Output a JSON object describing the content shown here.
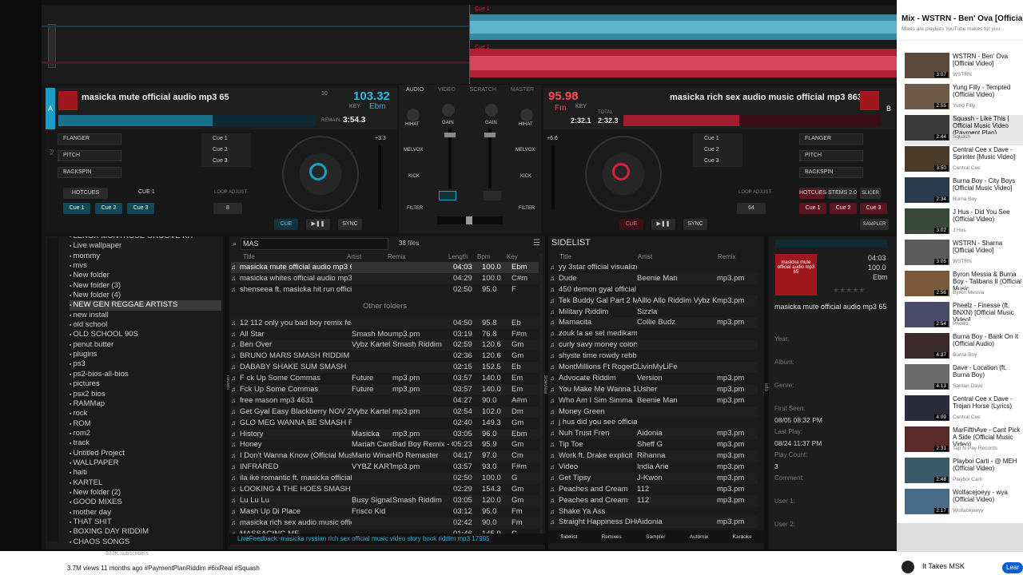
{
  "deckA": {
    "title": "masicka mute official audio mp3 65",
    "bpm": "103.32",
    "key_label": "KEY",
    "key": "Ebm",
    "time": "3:54.3",
    "remain": "REMAIN",
    "pitch": "10",
    "letter": "A"
  },
  "deckB": {
    "title": "masicka rich sex audio music official mp3 86339",
    "bpm": "95.98",
    "key_label": "KEY",
    "key": "Fm",
    "time1": "2:32.1",
    "time2": "2:32.3",
    "total": "TOTAL",
    "letter": "B"
  },
  "wave": {
    "cue_top": "Cue 1",
    "cue_bottom": "Cue 1"
  },
  "mixer": {
    "tabs": [
      "AUDIO",
      "VIDEO",
      "SCRATCH",
      "MASTER"
    ],
    "hihat": "HIHAT",
    "gain": "GAIN",
    "melvox": "MELVOX",
    "kick": "KICK",
    "filter": "FILTER"
  },
  "fxA": {
    "items": [
      "FLANGER",
      "PITCH",
      "BACKSPIN"
    ],
    "cues": [
      "Cue 1",
      "Cue 2",
      "Cue 3"
    ],
    "pads": [
      "Cue 1",
      "Cue 2",
      "Cue 3"
    ],
    "hotcues": "HOTCUES",
    "cue1": "CUE 1",
    "loop": "8",
    "plus": "+3.3",
    "cue": "CUE",
    "sync": "SYNC",
    "fx_label": "FX",
    "loop_adjust": "LOOP ADJUST",
    "pads_label": "PADS",
    "hotcue_label": "HOTCUE"
  },
  "fxB": {
    "items": [
      "FLANGER",
      "PITCH",
      "BACKSPIN"
    ],
    "cues": [
      "Cue 1",
      "Cue 2",
      "Cue 3"
    ],
    "pads": [
      "Cue 1",
      "Cue 2",
      "Cue 3"
    ],
    "pad_tabs": [
      "HOTCUES",
      "STEMS 2.0",
      "SLICER",
      "SAMPLER"
    ],
    "loop": "64",
    "plus": "+6.6",
    "cue": "CUE",
    "sync": "SYNC",
    "loop_adjust": "LOOP ADJUST"
  },
  "folders": [
    "LENOX MONTROSE GROOVE KIT",
    "Live wallpaper",
    "mommy",
    "mvs",
    "New folder",
    "New folder (3)",
    "New folder (4)",
    "NEW GEN REGGAE ARTISTS",
    "new install",
    "old school",
    "OLD SCHOOL 90S",
    "penut butter",
    "plugins",
    "ps3",
    "ps2-bios-all-bios",
    "pictures",
    "psx2 bios",
    "RAMMap",
    "rock",
    "ROM",
    "rom2",
    "track",
    "Untitled Project",
    "WALLPAPER",
    "haiti",
    "KARTEL",
    "New folder (2)",
    "GOOD MIXES",
    "mother day",
    "THAT SHIT",
    "BOXING DAY RIDDIM",
    "CHAOS SONGS"
  ],
  "search": {
    "value": "MAS",
    "count": "38 files"
  },
  "tracklist": {
    "headers": [
      "Title",
      "Artist",
      "Remix",
      "Length",
      "Bpm",
      "Key"
    ],
    "other": "Other folders",
    "rows": [
      [
        "masicka mute official audio mp3 65",
        "",
        "",
        "04:03",
        "100.0",
        "Ebm"
      ],
      [
        "masicka whites official audio mp3 77",
        "",
        "",
        "04:29",
        "100.0",
        "C#m"
      ],
      [
        "shenseea ft. masicka hit run official audio j...",
        "",
        "",
        "02:50",
        "95.0",
        "F"
      ],
      [
        "12 112 only you bad boy remix feat the not...",
        "",
        "",
        "04:50",
        "95.8",
        "Eb"
      ],
      [
        "All Star",
        "Smash Mouth",
        "mp3.pm",
        "03:19",
        "76.8",
        "F#m"
      ],
      [
        "Ben Over",
        "Vybz Kartel",
        "Smash Riddim",
        "02:59",
        "120.6",
        "Gm"
      ],
      [
        "BRUNO MARS SMASH RIDDIM",
        "",
        "",
        "02:36",
        "120.6",
        "Gm"
      ],
      [
        "DABABY SHAKE SUM SMASH",
        "",
        "",
        "02:15",
        "152.5",
        "Eb"
      ],
      [
        "F ck Up Some Commas",
        "Future",
        "mp3.pm",
        "03:57",
        "140.0",
        "Em"
      ],
      [
        "Fck Up Some Commas",
        "Future",
        "mp3.pm",
        "03:57",
        "140.0",
        "Em"
      ],
      [
        "free mason mp3 4631",
        "",
        "",
        "04:27",
        "90.0",
        "A#m"
      ],
      [
        "Get Gyal Easy Blackberry NOV 2010 Mast...",
        "Vybz Kartel",
        "mp3.pm",
        "02:54",
        "102.0",
        "Dm"
      ],
      [
        "GLO MEG WANNA BE SMASH RIDDIM",
        "",
        "",
        "02:40",
        "149.3",
        "Gm"
      ],
      [
        "History",
        "Masicka",
        "mp3.pm",
        "03:05",
        "96.0",
        "Ebm"
      ],
      [
        "Honey",
        "Mariah Carey",
        "Bad Boy Remix - Offici...",
        "05:23",
        "95.9",
        "Gm"
      ],
      [
        "I Don't Wanna Know (Official Music Video)",
        "Mario Winans",
        "HD Remaster",
        "04:17",
        "97.0",
        "Cm"
      ],
      [
        "INFRARED",
        "VYBZ KARTE...",
        "mp3.pm",
        "03:57",
        "93.0",
        "F#m"
      ],
      [
        "ila ike romantic ft. masicka official video m...",
        "",
        "",
        "02:50",
        "100.0",
        "G"
      ],
      [
        "LOOKING 4 THE HOES SMASH RIDDIM",
        "",
        "",
        "02:29",
        "154.3",
        "Gm"
      ],
      [
        "Lu Lu Lu",
        "Busy Signal",
        "Smash Riddim",
        "03:05",
        "120.0",
        "Gm"
      ],
      [
        "Mash Up Di Place",
        "Frisco Kid",
        "",
        "03:12",
        "95.0",
        "Fm"
      ],
      [
        "masicka rich sex audio music official mp3 8...",
        "",
        "",
        "02:42",
        "90.0",
        "Fm"
      ],
      [
        "MASSAGING ME",
        "",
        "",
        "01:46",
        "145.0",
        "C"
      ]
    ]
  },
  "sidelist": {
    "title": "SIDELIST",
    "headers": [
      "Title",
      "Artist",
      "Remix"
    ],
    "rows": [
      [
        "yy 3star official visualizer mp3 179",
        "",
        ""
      ],
      [
        "Dude",
        "Beenie Man",
        "mp3.pm"
      ],
      [
        "450 demon gyal official music vi...",
        "",
        ""
      ],
      [
        "Tek Buddy Gal Part 2 Main",
        "Alllo Allo Riddim Vybz Kartel",
        "mp3.pm"
      ],
      [
        "Military Riddim",
        "Sizzla",
        ""
      ],
      [
        "Mamacita",
        "Collie Budz",
        "mp3.pm"
      ],
      [
        "zouk la se sel medikaman nou...",
        "",
        ""
      ],
      [
        "curly savy money colors official...",
        "",
        ""
      ],
      [
        "shyste time rowdy rebbel ft bob...",
        "",
        ""
      ],
      [
        "MontMillions Ft RogerDeeM",
        "LivinMyLiFe",
        ""
      ],
      [
        "Advocate Riddim",
        "Version",
        "mp3.pm"
      ],
      [
        "You Make Me Wanna 1997",
        "Usher",
        "mp3.pm"
      ],
      [
        "Who Am I Sim Simma",
        "Beenie Man",
        "mp3.pm"
      ],
      [
        "Money Green",
        "",
        ""
      ],
      [
        "j hus did you see official video...",
        "",
        ""
      ],
      [
        "Nuh Trust Fren",
        "Aidonia",
        "mp3.pm"
      ],
      [
        "Tip Toe",
        "Sheff G",
        "mp3.pm"
      ],
      [
        "Work ft. Drake explicit",
        "Rihanna",
        "mp3.pm"
      ],
      [
        "Video",
        "India Arie",
        "mp3.pm"
      ],
      [
        "Get Tipsy",
        "J-Kwon",
        "mp3.pm"
      ],
      [
        "Peaches and Cream",
        "112",
        "mp3.pm"
      ],
      [
        "Peaches and Cream",
        "112",
        "mp3.pm"
      ],
      [
        "Shake Ya Ass",
        "",
        ""
      ],
      [
        "Straight Happiness DHQ su...",
        "Aidonia",
        "mp3.pm"
      ]
    ],
    "tabs": [
      "Sidelist",
      "Remixes",
      "Sampler",
      "Automix",
      "Karaoke"
    ]
  },
  "info": {
    "album_art": "masicka mute official audio mp3 65",
    "length": "04:03",
    "bpm": "100.0",
    "key": "Ebm",
    "title": "masicka mute official audio mp3 65",
    "fields": [
      "Year:",
      "Album:",
      "Genre:"
    ],
    "first_seen_label": "First Seen:",
    "first_seen": "08/05 08:32 PM",
    "last_play_label": "Last Play:",
    "last_play": "08/24 11:37 PM",
    "play_count_label": "Play Count:",
    "play_count": "3",
    "comment": "Comment:",
    "user1": "User 1:",
    "user2": "User 2:"
  },
  "side_tabs": {
    "folders": "folders",
    "sideview": "sideview",
    "info": "info"
  },
  "livefeedback": "LiveFeedback: masicka rvssian rich sex official music video story book riddim mp3 17995",
  "yt": {
    "mix_title": "Mix - WSTRN - Ben' Ova [Official",
    "mix_sub": "Mixes are playlists YouTube makes for you",
    "videos": [
      [
        "WSTRN - Ben' Ova [Official Video]",
        "WSTRN",
        "3:07"
      ],
      [
        "Yung Filly - Tempted (Official Video)",
        "Yung Filly",
        "2:55"
      ],
      [
        "Squash - Like This | Official Music Video (Payment Plan)",
        "Squash",
        "2:44"
      ],
      [
        "Central Cee x Dave - Sprinter [Music Video]",
        "Central Cee",
        "3:50"
      ],
      [
        "Burna Boy - City Boys [Official Music Video]",
        "Burna Boy",
        "2:34"
      ],
      [
        "J Hus - Did You See (Official Video)",
        "J Hus",
        "3:02"
      ],
      [
        "WSTRN - Sharna [Official Video]",
        "WSTRN",
        "3:05"
      ],
      [
        "Byron Messia & Burna Boy - Talibans II (Official Music...",
        "Byron Messia",
        "2:56"
      ],
      [
        "Pheelz - Finesse (ft. BNXN) [Official Music Video]",
        "Pheelz",
        "2:54"
      ],
      [
        "Burna Boy - Bank On It (Official Audio)",
        "Burna Boy",
        "4:37"
      ],
      [
        "Dave - Location (ft. Burna Boy)",
        "Santan Dave",
        "4:13"
      ],
      [
        "Central Cee x Dave - Trojan Horse (Lyrics)",
        "Central Cee",
        "4:09"
      ],
      [
        "MarFifthAve - Cant Pick A Side (Official Music Video)",
        "Tap N Pay Records",
        "2:31"
      ],
      [
        "Playboi Carti - @ MEH (Official Video)",
        "Playboi Carti",
        "2:48"
      ],
      [
        "Wolfacejoeyy - wya (Official Video)",
        "Wolfacejoeyy",
        "2:17"
      ]
    ],
    "views": "3.7M views  11 months ago  #PaymentPlanRiddim #6ixReal #Squash",
    "subs": "333K subscribers",
    "channel": "It Takes MSK",
    "learn": "Lear"
  },
  "colors": {
    "accentA": "#1a9fc2",
    "accentB": "#d8213b",
    "panel": "#1b1b1b"
  }
}
